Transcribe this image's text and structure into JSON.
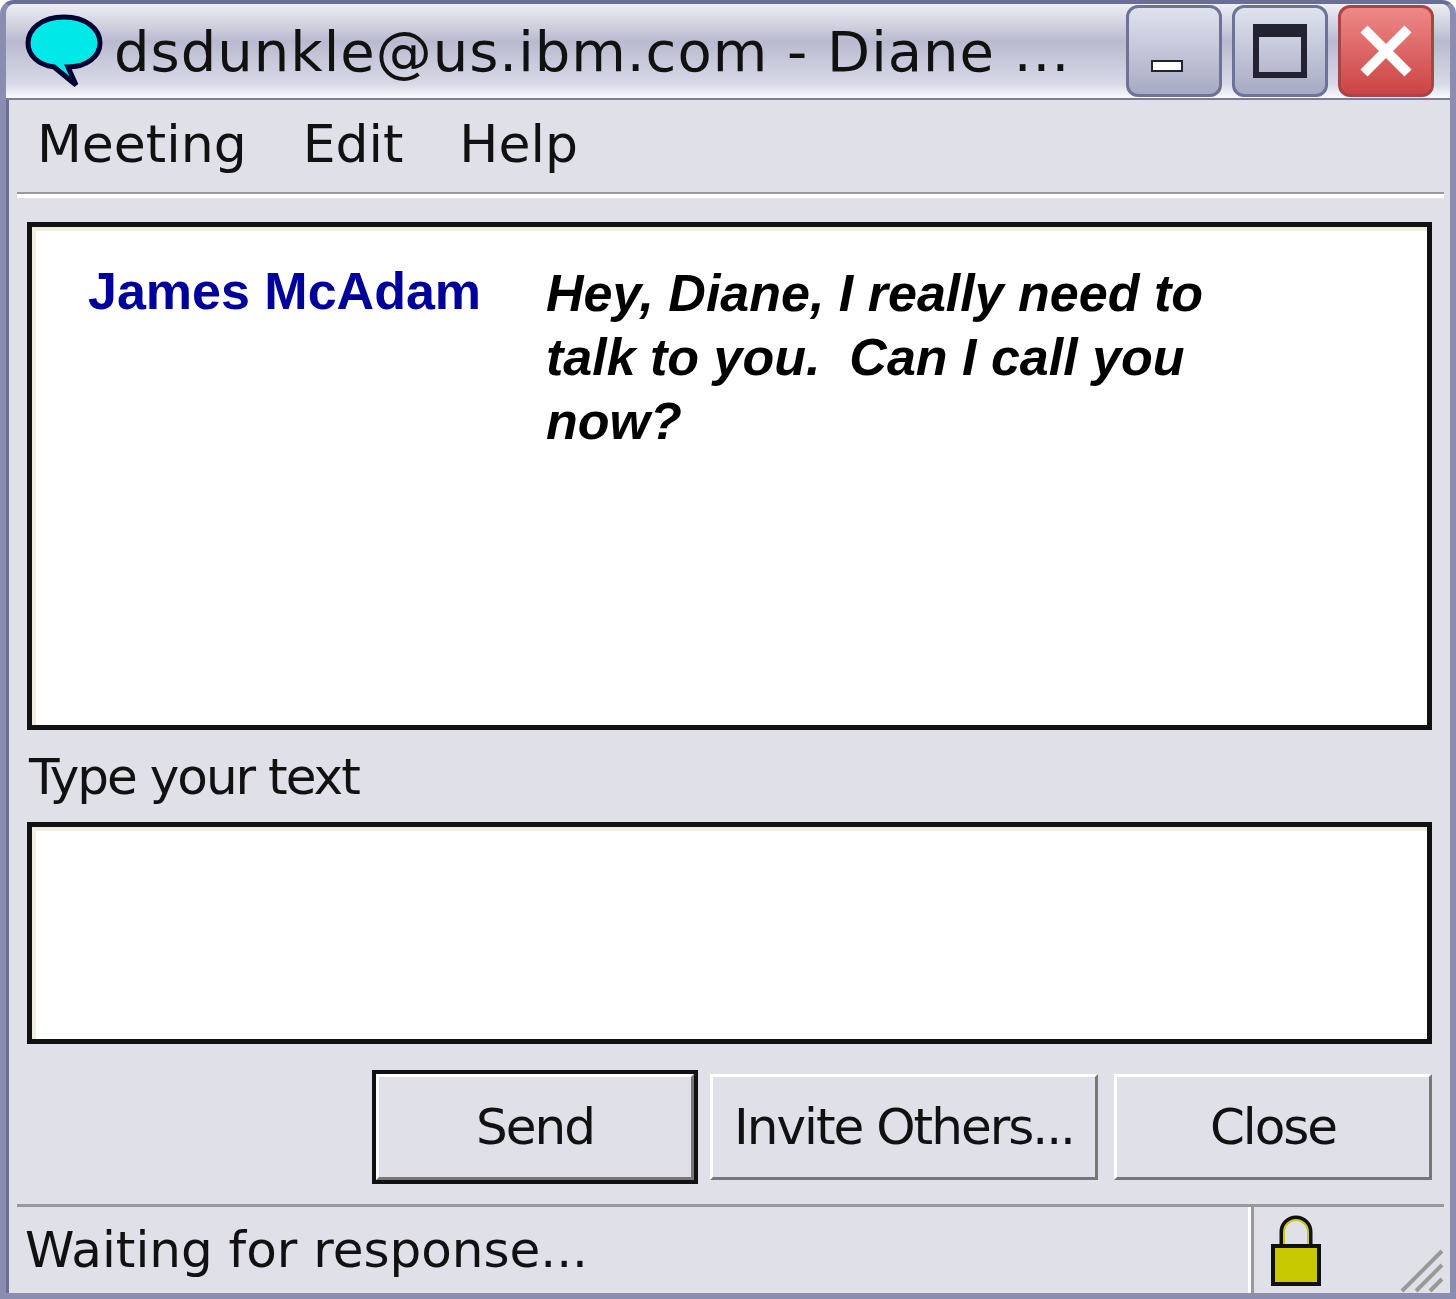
{
  "window": {
    "title": "dsdunkle@us.ibm.com - Diane ..."
  },
  "menu": [
    "Meeting",
    "Edit",
    "Help"
  ],
  "transcript": [
    {
      "sender": "James McAdam",
      "message": "Hey, Diane, I really need to talk to you.  Can I call you now?"
    }
  ],
  "input": {
    "label": "Type your text"
  },
  "buttons": [
    {
      "label": "Send",
      "default": true
    },
    {
      "label": "Invite Others...",
      "default": false
    },
    {
      "label": "Close",
      "default": false
    }
  ],
  "status_bar": {
    "text": "Waiting for response..."
  }
}
